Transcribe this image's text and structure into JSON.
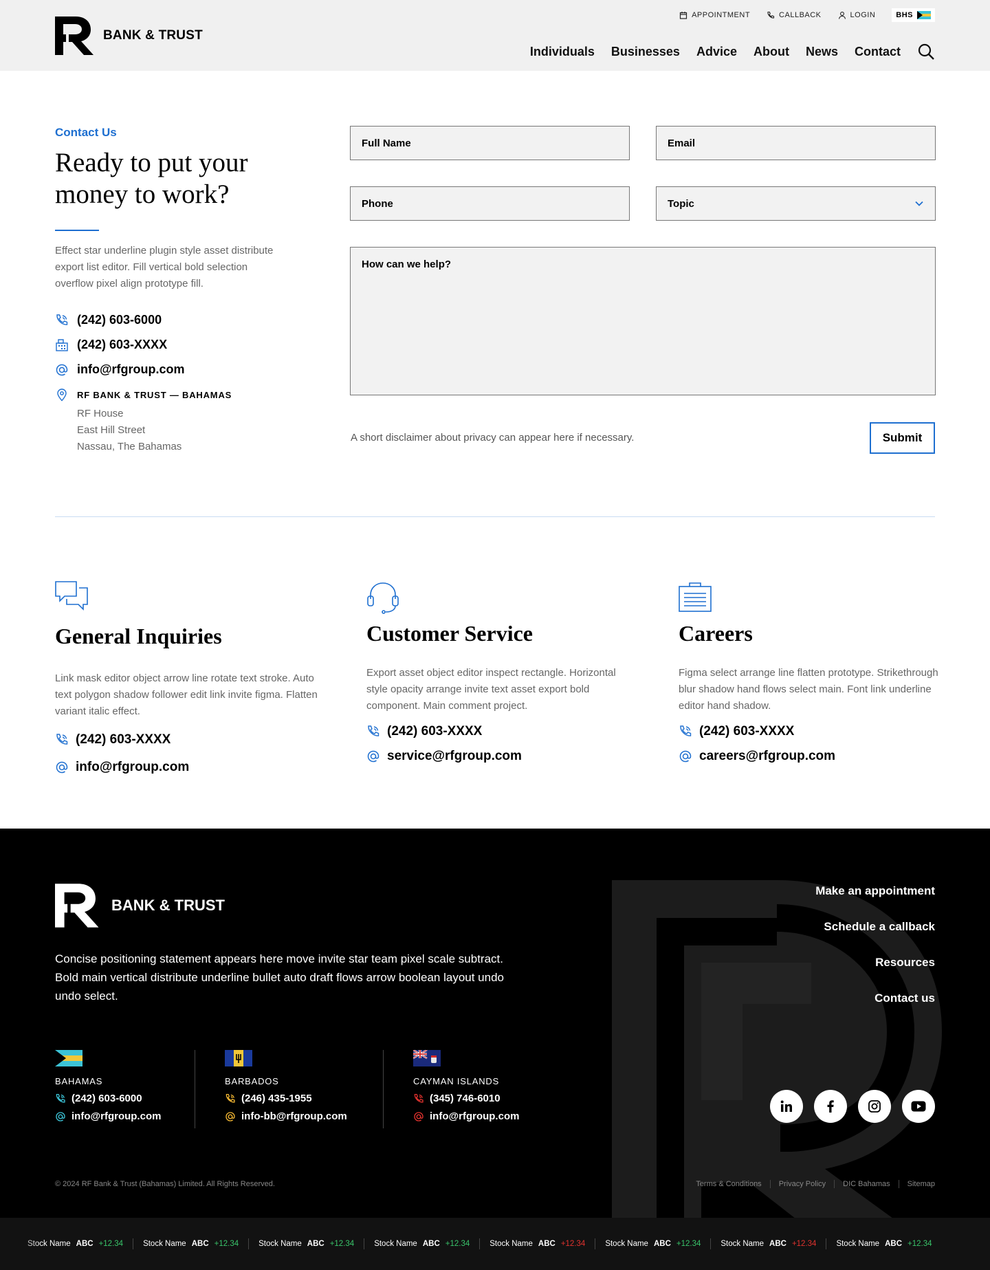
{
  "header": {
    "brand": "BANK & TRUST",
    "utility": {
      "appointment": "APPOINTMENT",
      "callback": "CALLBACK",
      "login": "LOGIN",
      "lang": "BHS"
    },
    "nav": [
      "Individuals",
      "Businesses",
      "Advice",
      "About",
      "News",
      "Contact"
    ]
  },
  "contact": {
    "eyebrow": "Contact Us",
    "title": "Ready to put your money to work?",
    "description": "Effect star underline plugin style asset distribute export list editor. Fill vertical bold selection overflow pixel align prototype fill.",
    "phone": "(242) 603-6000",
    "fax": "(242) 603-XXXX",
    "email": "info@rfgroup.com",
    "address_heading": "RF BANK & TRUST — BAHAMAS",
    "address_lines": [
      "RF House",
      "East Hill Street",
      "Nassau, The Bahamas"
    ]
  },
  "form": {
    "full_name": "Full Name",
    "email": "Email",
    "phone": "Phone",
    "topic": "Topic",
    "message": "How can we help?",
    "disclaimer": "A short disclaimer about privacy can appear here if necessary.",
    "submit": "Submit"
  },
  "cards": [
    {
      "title": "General Inquiries",
      "description": "Link mask editor object arrow line rotate text stroke. Auto text polygon shadow follower edit link invite figma. Flatten variant italic effect.",
      "phone": "(242) 603-XXXX",
      "email": "info@rfgroup.com"
    },
    {
      "title": "Customer Service",
      "description": "Export asset object editor inspect rectangle. Horizontal style opacity arrange invite text asset export bold component. Main comment project.",
      "phone": "(242) 603-XXXX",
      "email": "service@rfgroup.com"
    },
    {
      "title": "Careers",
      "description": "Figma select arrange line flatten prototype. Strikethrough blur shadow hand flows select main. Font link underline editor hand shadow.",
      "phone": "(242) 603-XXXX",
      "email": "careers@rfgroup.com"
    }
  ],
  "footer": {
    "brand": "BANK & TRUST",
    "statement": "Concise positioning statement appears here move invite star team pixel scale subtract. Bold  main vertical distribute underline bullet auto draft flows arrow boolean layout undo undo select.",
    "links": [
      "Make an appointment",
      "Schedule a callback",
      "Resources",
      "Contact us"
    ],
    "regions": [
      {
        "name": "BAHAMAS",
        "phone": "(242) 603-6000",
        "email": "info@rfgroup.com",
        "accent": "#3cc3d6"
      },
      {
        "name": "BARBADOS",
        "phone": "(246) 435-1955",
        "email": "info-bb@rfgroup.com",
        "accent": "#f2b632"
      },
      {
        "name": "CAYMAN ISLANDS",
        "phone": "(345) 746-6010",
        "email": "info@rfgroup.com",
        "accent": "#e0322e"
      }
    ],
    "social": [
      "linkedin-icon",
      "facebook-icon",
      "instagram-icon",
      "youtube-icon"
    ],
    "copyright": "© 2024 RF Bank & Trust (Bahamas) Limited. All Rights Reserved.",
    "legal": [
      "Terms & Conditions",
      "Privacy Policy",
      "DIC Bahamas",
      "Sitemap"
    ]
  },
  "ticker": [
    {
      "name": "Stock Name",
      "symbol": "ABC",
      "change": "+12.34",
      "direction": "up"
    },
    {
      "name": "Stock Name",
      "symbol": "ABC",
      "change": "+12.34",
      "direction": "up"
    },
    {
      "name": "Stock Name",
      "symbol": "ABC",
      "change": "+12.34",
      "direction": "up"
    },
    {
      "name": "Stock Name",
      "symbol": "ABC",
      "change": "+12.34",
      "direction": "up"
    },
    {
      "name": "Stock Name",
      "symbol": "ABC",
      "change": "+12.34",
      "direction": "down"
    },
    {
      "name": "Stock Name",
      "symbol": "ABC",
      "change": "+12.34",
      "direction": "up"
    },
    {
      "name": "Stock Name",
      "symbol": "ABC",
      "change": "+12.34",
      "direction": "down"
    },
    {
      "name": "Stock Name",
      "symbol": "ABC",
      "change": "+12.34",
      "direction": "up"
    }
  ],
  "colors": {
    "accent": "#1e6fd0",
    "header_bg": "#f0f0f0",
    "footer_bg": "#000000",
    "ticker_up": "#39c46a",
    "ticker_down": "#e0322e"
  }
}
